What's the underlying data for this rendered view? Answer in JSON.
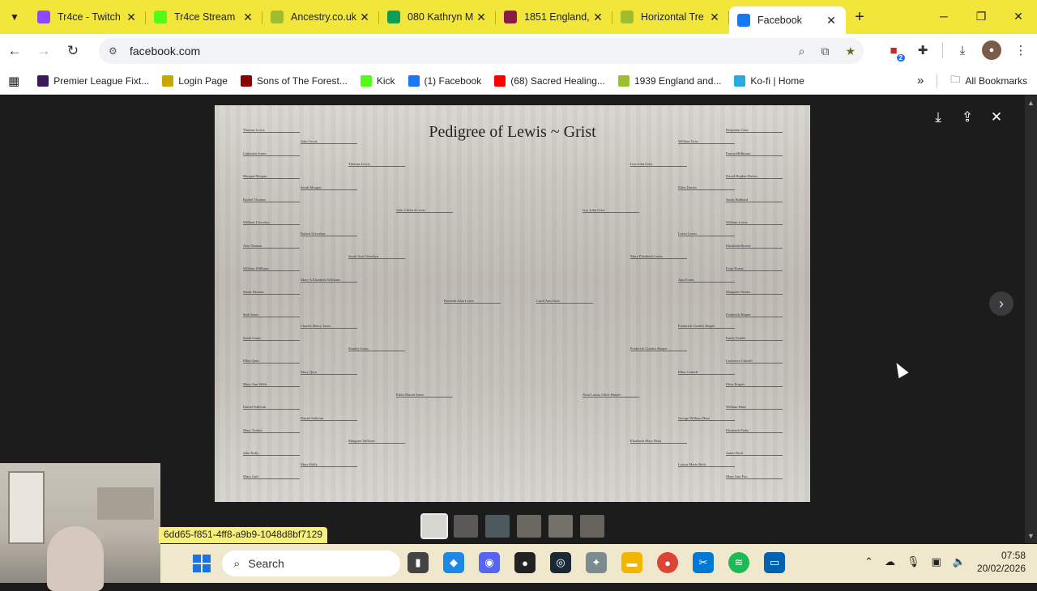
{
  "browser": {
    "tabs": [
      {
        "title": "Tr4ce - Twitch",
        "favicon": "twitch-icon",
        "color": "#9146ff"
      },
      {
        "title": "Tr4ce Stream",
        "favicon": "kick-icon",
        "color": "#53fc18"
      },
      {
        "title": "Ancestry.co.uk",
        "favicon": "leaf-icon",
        "color": "#9cbe30"
      },
      {
        "title": "080 Kathryn M",
        "favicon": "sheets-icon",
        "color": "#0f9d58"
      },
      {
        "title": "1851 England,",
        "favicon": "record-icon",
        "color": "#8b1a4a"
      },
      {
        "title": "Horizontal Tre",
        "favicon": "leaf-icon",
        "color": "#9cbe30"
      },
      {
        "title": "Facebook",
        "favicon": "facebook-icon",
        "color": "#1877f2",
        "active": true
      }
    ],
    "new_tab": "+",
    "url": "facebook.com",
    "extension_badge": "2"
  },
  "bookmarks": [
    {
      "label": "Premier League Fixt...",
      "icon": "premier-league-icon",
      "color": "#3d195b"
    },
    {
      "label": "Login Page",
      "icon": "login-icon",
      "color": "#c8a800"
    },
    {
      "label": "Sons of The Forest...",
      "icon": "game-icon",
      "color": "#8b0000"
    },
    {
      "label": "Kick",
      "icon": "kick-icon",
      "color": "#53fc18"
    },
    {
      "label": "(1) Facebook",
      "icon": "facebook-icon",
      "color": "#1877f2"
    },
    {
      "label": "(68) Sacred Healing...",
      "icon": "youtube-icon",
      "color": "#ff0000"
    },
    {
      "label": "1939 England and...",
      "icon": "leaf-icon",
      "color": "#9cbe30"
    },
    {
      "label": "Ko-fi | Home",
      "icon": "kofi-icon",
      "color": "#29abe0"
    }
  ],
  "bookmarks_more": "»",
  "all_bookmarks": "All Bookmarks",
  "viewer": {
    "pedigree_title": "Pedigree of Lewis ~ Grist",
    "left_names": [
      "Thomas Lewis",
      "Catherine Jones",
      "Morgan Morgan",
      "Rachel Thomas",
      "William Llewelyn",
      "Ann Thomas",
      "William Williams",
      "Sarah Thomas",
      "Seth Jones",
      "Sarah Grant",
      "Ellen Quin",
      "Mary Ann Wells",
      "Daniel Sullivan",
      "Mary Torbett",
      "John Kelly",
      "Mary Gaff"
    ],
    "left_parents": [
      "John Lewis",
      "Sarah Morgan",
      "Robert Llewelyn",
      "Mary A Elizabeth Williams",
      "Charles Henry Jones",
      "Mary Quin",
      "Daniel Sullivan",
      "Mary Kelly"
    ],
    "left_grandparents": [
      "Thomas Lewis",
      "Sarah Ann Llewelyn",
      "Stanley Jones",
      "Margaret Sullivan"
    ],
    "left_gg": [
      "John Clifford Lewis",
      "Edith Muriel Jones"
    ],
    "center_left": "Kenneth John Lewis",
    "center_right": "Carol Ann Grist",
    "right_gg": [
      "Ivor John Grist",
      "Nora Louisa Olive Harper"
    ],
    "right_grandparents": [
      "Ivor John Grist",
      "Mary Elizabeth Lewis",
      "Frederick Charles Harper",
      "Elizabeth Mary Hunt"
    ],
    "right_parents": [
      "William Grist",
      "Ellen Davies",
      "Lewis Lewis",
      "Ann Evans",
      "Frederick Charles Harper",
      "Ellen Cottrell",
      "George William Hunt",
      "Louisa Maria Beck"
    ],
    "right_names": [
      "Benjamin Grist",
      "Emma Hillhouse",
      "David Hopkin Davies",
      "Sarah Hubbard",
      "William Lewis",
      "Elizabeth Brown",
      "Evan Evans",
      "Margaret Owens",
      "Frederick Harper",
      "Emily Franks",
      "Lawrence Cottrell",
      "Eliza Rogers",
      "William Hunt",
      "Elizabeth Parke",
      "James Beck",
      "Mary Ann Fox"
    ]
  },
  "status_url": "6dd65-f851-4ff8-a9b9-1048d8bf7129",
  "taskbar": {
    "search_placeholder": "Search",
    "time": "07:58",
    "date": "20/02/2026"
  }
}
